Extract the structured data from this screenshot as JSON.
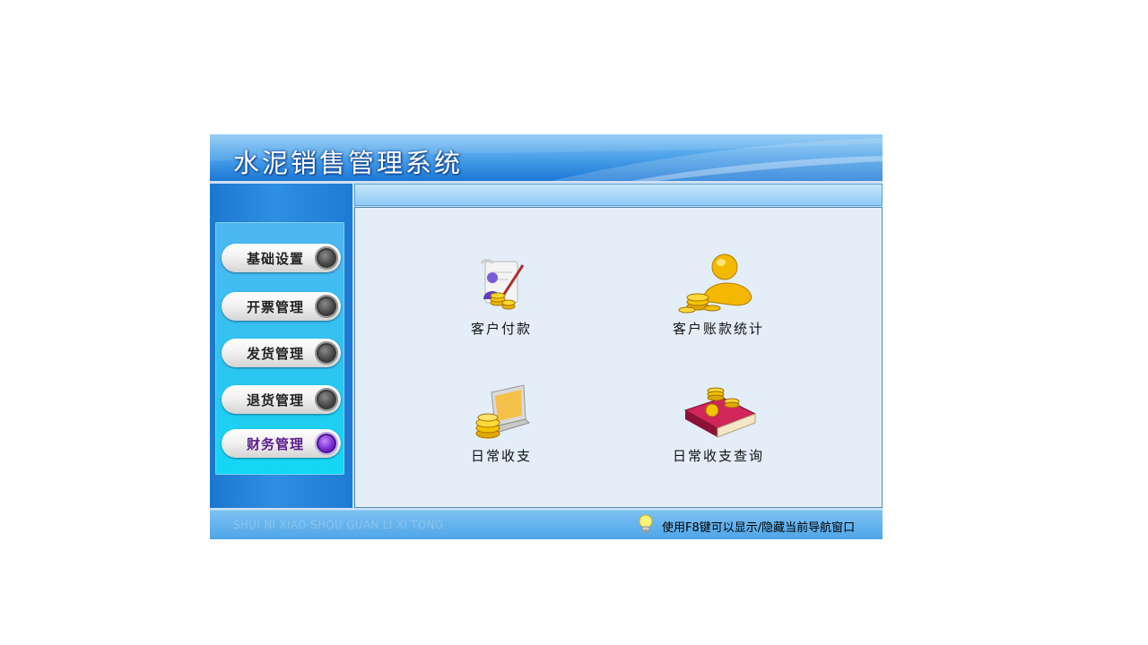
{
  "header": {
    "title": "水泥销售管理系统"
  },
  "sidebar": {
    "items": [
      {
        "label": "基础设置",
        "active": false
      },
      {
        "label": "开票管理",
        "active": false
      },
      {
        "label": "发货管理",
        "active": false
      },
      {
        "label": "退货管理",
        "active": false
      },
      {
        "label": "财务管理",
        "active": true
      }
    ]
  },
  "main": {
    "features": [
      {
        "label": "客户付款",
        "icon": "customer-payment-icon"
      },
      {
        "label": "客户账款统计",
        "icon": "account-statistics-icon"
      },
      {
        "label": "日常收支",
        "icon": "daily-income-expense-icon"
      },
      {
        "label": "日常收支查询",
        "icon": "income-expense-query-icon"
      }
    ]
  },
  "footer": {
    "pinyin": "SHUI NI XIAO SHOU GUAN LI XI TONG",
    "hint": "使用F8键可以显示/隐藏当前导航窗口"
  },
  "colors": {
    "banner": "#1c77d6",
    "content_bg": "#e4eef9",
    "active_knob": "#7b2fd8"
  }
}
